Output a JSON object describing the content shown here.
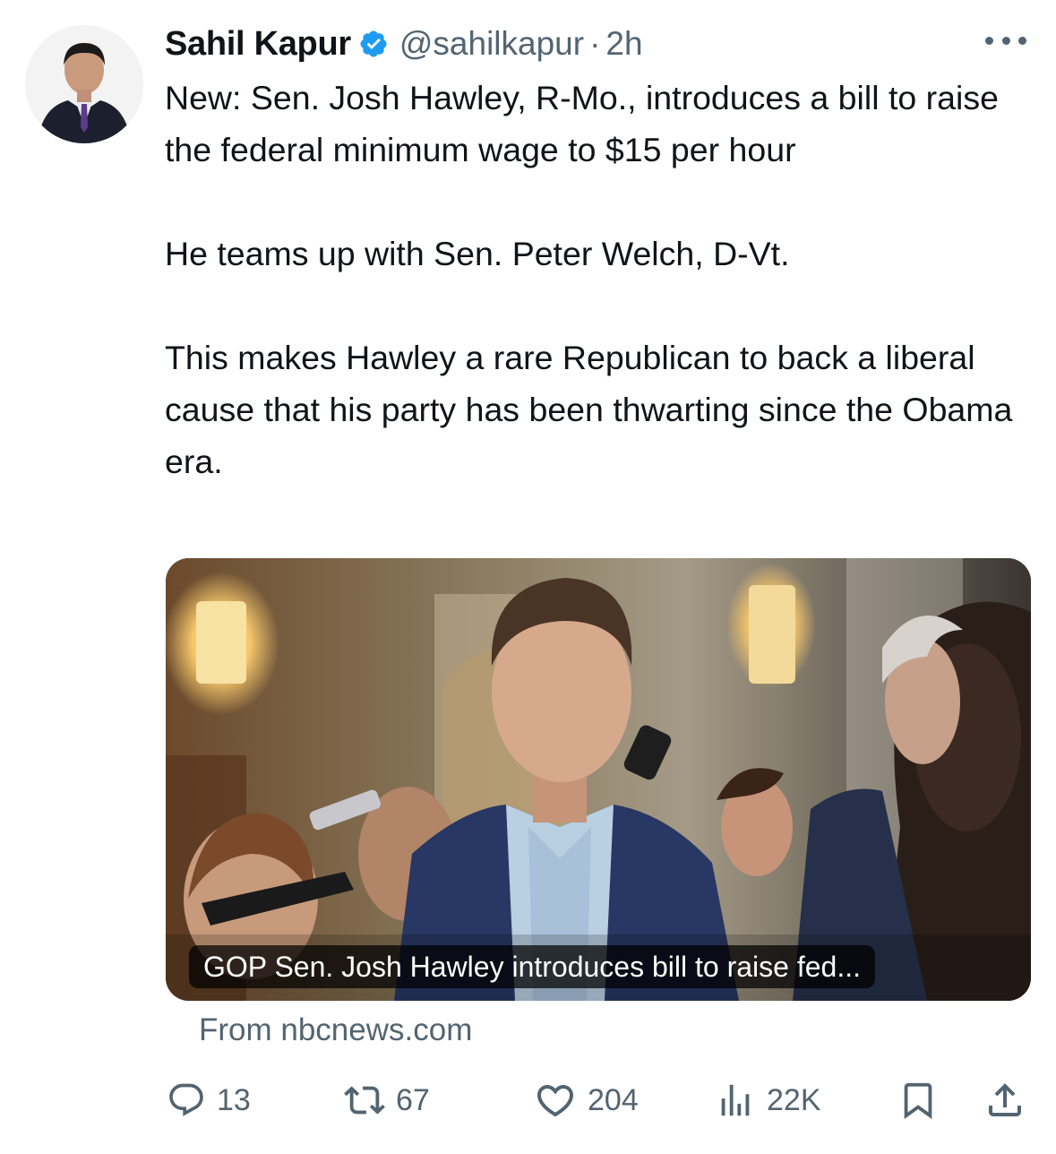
{
  "tweet": {
    "display_name": "Sahil Kapur",
    "verified_icon": "verified-badge-icon",
    "handle": "@sahilkapur",
    "separator": "·",
    "time": "2h",
    "more_icon": "more-icon",
    "text_paragraphs": [
      "New: Sen. Josh Hawley, R-Mo., introduces a bill to raise the federal minimum wage to $15 per hour",
      "He teams up with Sen. Peter Welch, D-Vt.",
      "This makes Hawley a rare Republican to back a liberal cause that his party has been thwarting since the Obama era."
    ]
  },
  "link_card": {
    "caption": "GOP Sen. Josh Hawley introduces bill to raise fed...",
    "source": "From nbcnews.com"
  },
  "actions": {
    "replies": {
      "icon": "reply-icon",
      "count": "13"
    },
    "reposts": {
      "icon": "repost-icon",
      "count": "67"
    },
    "likes": {
      "icon": "like-icon",
      "count": "204"
    },
    "views": {
      "icon": "views-icon",
      "count": "22K"
    },
    "bookmark": {
      "icon": "bookmark-icon"
    },
    "share": {
      "icon": "share-icon"
    }
  },
  "colors": {
    "text": "#0f1419",
    "secondary": "#536471",
    "verified": "#1d9bf0"
  }
}
